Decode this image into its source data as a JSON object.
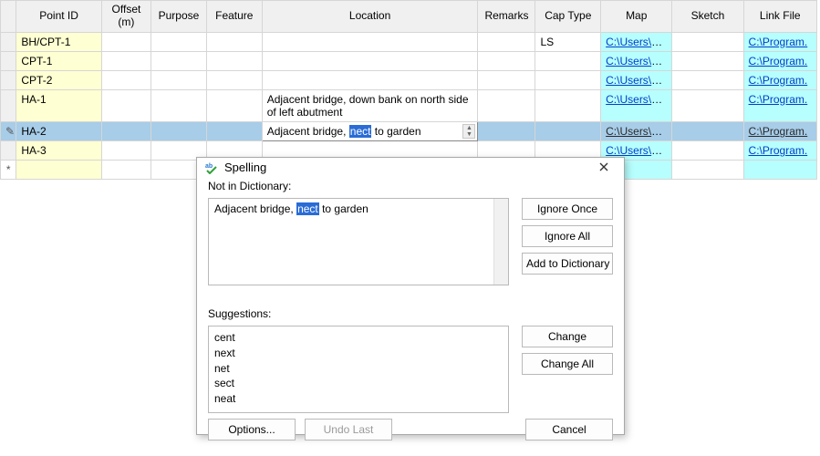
{
  "columns": {
    "pointId": "Point ID",
    "offset": "Offset (m)",
    "purpose": "Purpose",
    "feature": "Feature",
    "location": "Location",
    "remarks": "Remarks",
    "capType": "Cap Type",
    "map": "Map",
    "sketch": "Sketch",
    "linkFile": "Link File"
  },
  "rows": [
    {
      "pointId": "BH/CPT-1",
      "location": "",
      "capType": "LS",
      "map": "C:\\Users\\Ri...",
      "linkFile": "C:\\Program."
    },
    {
      "pointId": "CPT-1",
      "location": "",
      "capType": "",
      "map": "C:\\Users\\Ri...",
      "linkFile": "C:\\Program."
    },
    {
      "pointId": "CPT-2",
      "location": "",
      "capType": "",
      "map": "C:\\Users\\Ri...",
      "linkFile": "C:\\Program."
    },
    {
      "pointId": "HA-1",
      "location": "Adjacent bridge, down bank on north side of left abutment",
      "capType": "",
      "map": "C:\\Users\\Ri...",
      "linkFile": "C:\\Program."
    },
    {
      "pointId": "HA-2",
      "location_pre": "Adjacent bridge, ",
      "location_hl": "nect",
      "location_post": " to garden",
      "capType": "",
      "map": "C:\\Users\\Ri...",
      "linkFile": "C:\\Program."
    },
    {
      "pointId": "HA-3",
      "location": "",
      "capType": "",
      "map": "C:\\Users\\Ri...",
      "linkFile": "C:\\Program."
    }
  ],
  "editGlyph": "✎",
  "newRowGlyph": "*",
  "dialog": {
    "title": "Spelling",
    "notInDictLabel": "Not in Dictionary:",
    "text_pre": "Adjacent bridge, ",
    "text_hl": "nect",
    "text_post": " to garden",
    "suggestionsLabel": "Suggestions:",
    "suggestions": [
      "cent",
      "next",
      "net",
      "sect",
      "neat"
    ],
    "buttons": {
      "ignoreOnce": "Ignore Once",
      "ignoreAll": "Ignore All",
      "addToDict": "Add to Dictionary",
      "change": "Change",
      "changeAll": "Change All",
      "options": "Options...",
      "undoLast": "Undo Last",
      "cancel": "Cancel"
    }
  }
}
